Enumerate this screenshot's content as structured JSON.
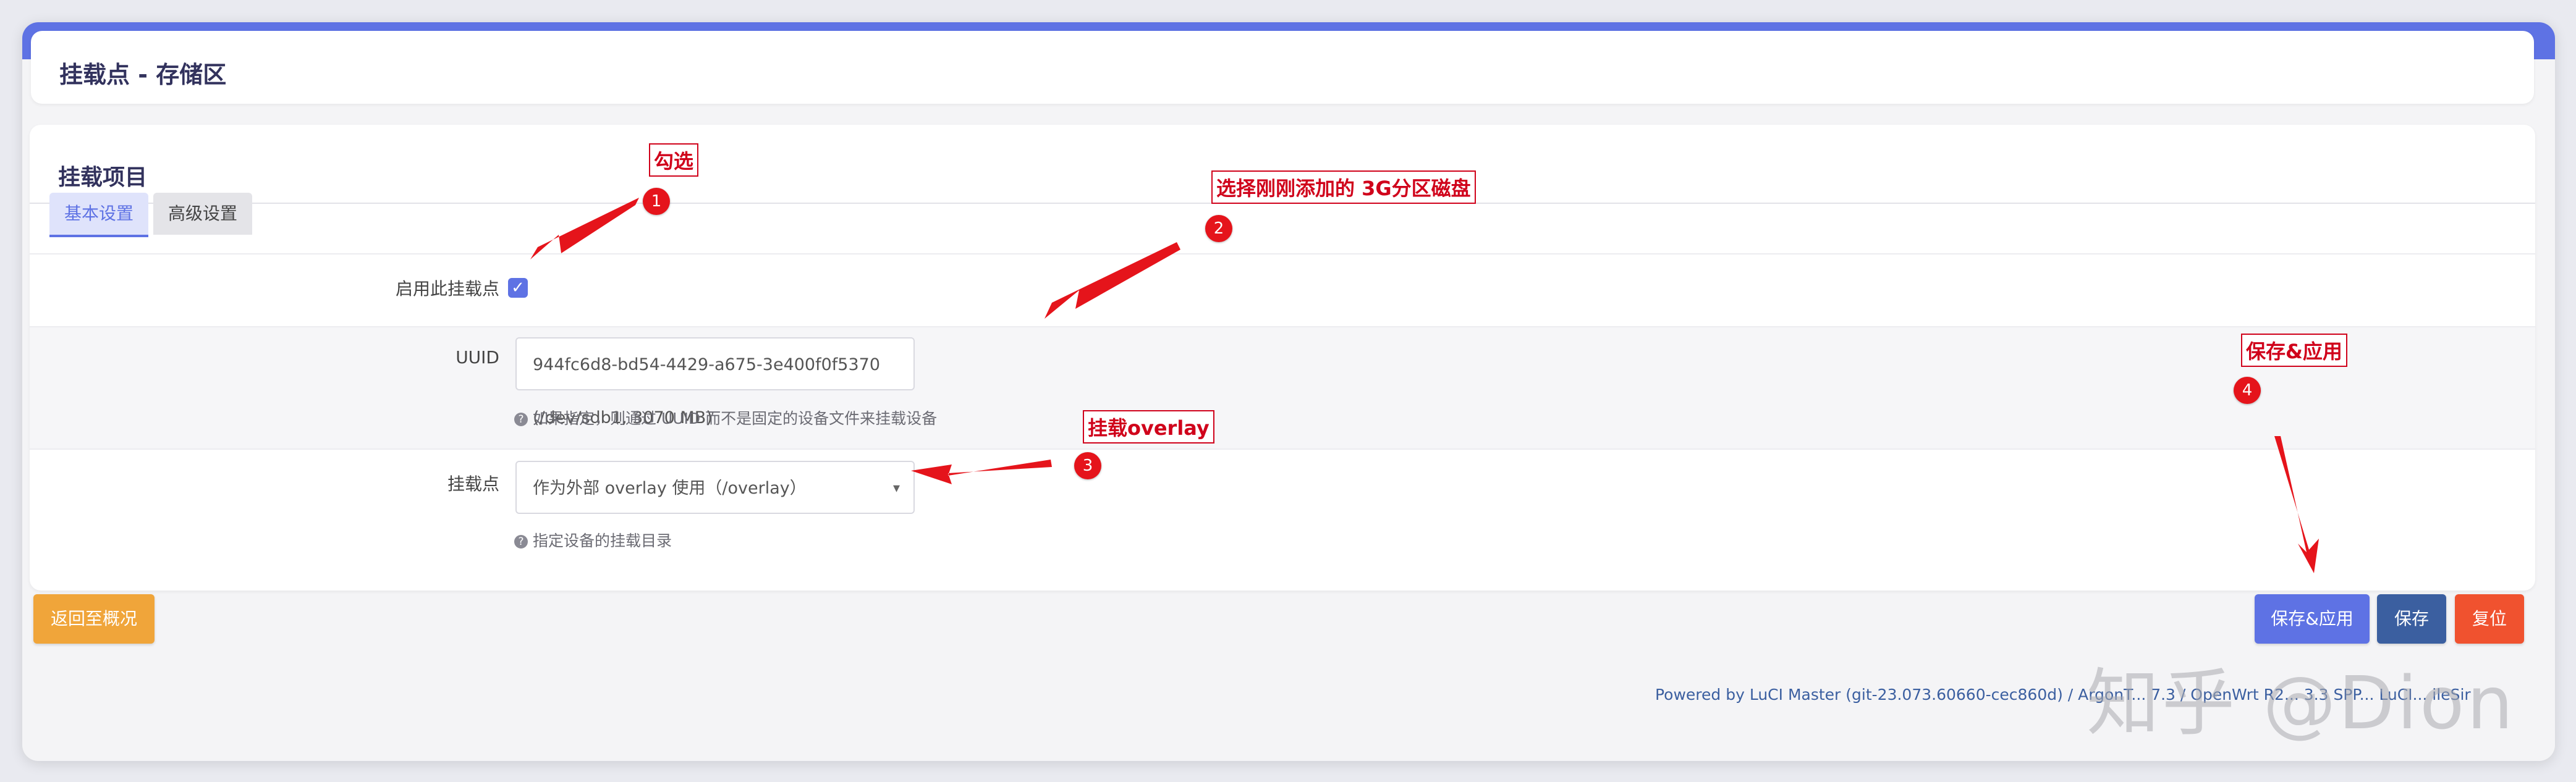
{
  "page": {
    "title": "挂载点 - 存储区"
  },
  "section": {
    "title": "挂载项目",
    "tabs": [
      {
        "label": "基本设置"
      },
      {
        "label": "高级设置"
      }
    ]
  },
  "form": {
    "enable": {
      "label": "启用此挂载点",
      "checked": true
    },
    "uuid": {
      "label": "UUID",
      "value": "944fc6d8-bd54-4429-a675-3e400f0f5370 (/dev/sdb1, 3070 MB)",
      "hint": "如果指定，则通过 UUID 而不是固定的设备文件来挂载设备"
    },
    "mountpoint": {
      "label": "挂载点",
      "value": "作为外部 overlay 使用（/overlay）",
      "hint": "指定设备的挂载目录"
    }
  },
  "buttons": {
    "back": "返回至概况",
    "save_apply": "保存&应用",
    "save": "保存",
    "reset": "复位"
  },
  "footer": "Powered by LuCI Master (git-23.073.60660-cec860d) / ArgonT... 7.3 / OpenWrt R2... 3.3 SPP... LuCI... ileSir",
  "watermark": "知乎 @Dion",
  "annotations": [
    {
      "num": "1",
      "text": "勾选"
    },
    {
      "num": "2",
      "text": "选择刚刚添加的 3G分区磁盘"
    },
    {
      "num": "3",
      "text": "挂载overlay"
    },
    {
      "num": "4",
      "text": "保存&应用"
    }
  ],
  "colors": {
    "accent": "#5e72e4",
    "annotation": "#e5141b",
    "back_button": "#f0a53a",
    "save_button": "#3b5fa0",
    "reset_button": "#f0522f"
  }
}
